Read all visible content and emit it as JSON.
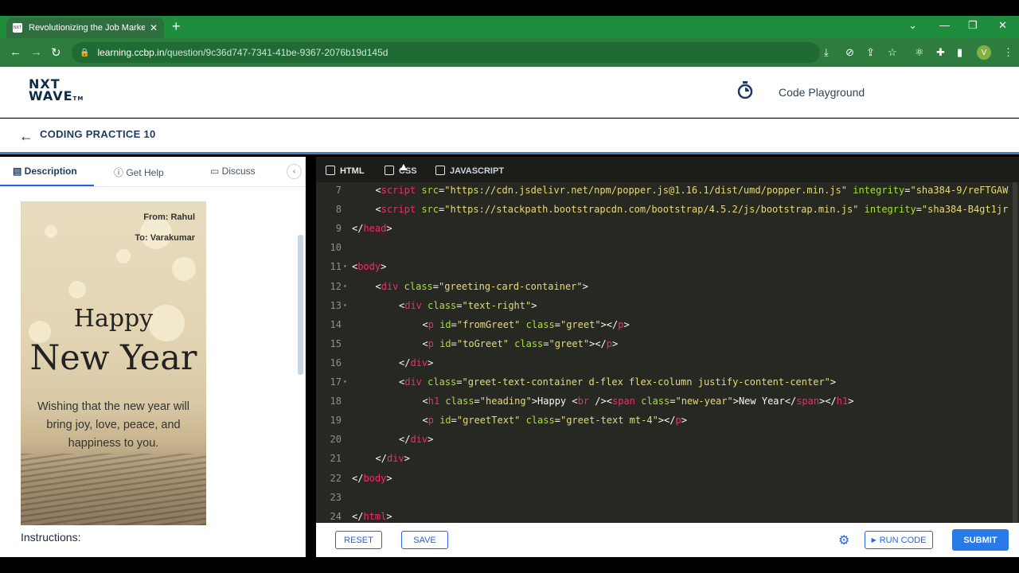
{
  "browser": {
    "tab_title": "Revolutionizing the Job Market |",
    "url_host": "learning.ccbp.in",
    "url_path": "/question/9c36d747-7341-41be-9367-2076b19d145d",
    "avatar_letter": "V",
    "favicon_text": "NXT"
  },
  "site": {
    "logo_line1": "NXT",
    "logo_line2": "WAVE",
    "logo_tm": "TM",
    "playground_label": "Code Playground",
    "practice_title": "CODING PRACTICE 10"
  },
  "left_tabs": {
    "description": "Description",
    "get_help": "Get Help",
    "discuss": "Discuss"
  },
  "card": {
    "from": "From: Rahul",
    "to": "To: Varakumar",
    "happy": "Happy",
    "new_year": "New Year",
    "wish": "Wishing that the new year will bring joy, love, peace, and happiness to you."
  },
  "instructions_label": "Instructions:",
  "editor_tabs": {
    "html": "HTML",
    "css": "CSS",
    "js": "JAVASCRIPT"
  },
  "code_lines": [
    {
      "n": "7",
      "indent": 1,
      "parts": [
        [
          "p",
          "<"
        ],
        [
          "tg",
          "script"
        ],
        [
          "p",
          " "
        ],
        [
          "at",
          "src"
        ],
        [
          "p",
          "="
        ],
        [
          "st",
          "\"https://cdn.jsdelivr.net/npm/popper.js@1.16.1/dist/umd/popper.min.js\""
        ],
        [
          "p",
          " "
        ],
        [
          "at",
          "integrity"
        ],
        [
          "p",
          "="
        ],
        [
          "st",
          "\"sha384-9/reFTGAW"
        ]
      ]
    },
    {
      "n": "8",
      "indent": 1,
      "parts": [
        [
          "p",
          "<"
        ],
        [
          "tg",
          "script"
        ],
        [
          "p",
          " "
        ],
        [
          "at",
          "src"
        ],
        [
          "p",
          "="
        ],
        [
          "st",
          "\"https://stackpath.bootstrapcdn.com/bootstrap/4.5.2/js/bootstrap.min.js\""
        ],
        [
          "p",
          " "
        ],
        [
          "at",
          "integrity"
        ],
        [
          "p",
          "="
        ],
        [
          "st",
          "\"sha384-B4gt1jr"
        ]
      ]
    },
    {
      "n": "9",
      "indent": 0,
      "parts": [
        [
          "p",
          "</"
        ],
        [
          "tg",
          "head"
        ],
        [
          "p",
          ">"
        ]
      ]
    },
    {
      "n": "10",
      "indent": 0,
      "parts": []
    },
    {
      "n": "11",
      "indent": 0,
      "fold": true,
      "parts": [
        [
          "p",
          "<"
        ],
        [
          "tg",
          "body"
        ],
        [
          "p",
          ">"
        ]
      ]
    },
    {
      "n": "12",
      "indent": 1,
      "fold": true,
      "parts": [
        [
          "p",
          "<"
        ],
        [
          "tg",
          "div"
        ],
        [
          "p",
          " "
        ],
        [
          "at",
          "class"
        ],
        [
          "p",
          "="
        ],
        [
          "st",
          "\"greeting-card-container\""
        ],
        [
          "p",
          ">"
        ]
      ]
    },
    {
      "n": "13",
      "indent": 2,
      "fold": true,
      "parts": [
        [
          "p",
          "<"
        ],
        [
          "tg",
          "div"
        ],
        [
          "p",
          " "
        ],
        [
          "at",
          "class"
        ],
        [
          "p",
          "="
        ],
        [
          "st",
          "\"text-right\""
        ],
        [
          "p",
          ">"
        ]
      ]
    },
    {
      "n": "14",
      "indent": 3,
      "parts": [
        [
          "p",
          "<"
        ],
        [
          "tg",
          "p"
        ],
        [
          "p",
          " "
        ],
        [
          "at",
          "id"
        ],
        [
          "p",
          "="
        ],
        [
          "st",
          "\"fromGreet\""
        ],
        [
          "p",
          " "
        ],
        [
          "at",
          "class"
        ],
        [
          "p",
          "="
        ],
        [
          "st",
          "\"greet\""
        ],
        [
          "p",
          "></"
        ],
        [
          "tg",
          "p"
        ],
        [
          "p",
          ">"
        ]
      ]
    },
    {
      "n": "15",
      "indent": 3,
      "parts": [
        [
          "p",
          "<"
        ],
        [
          "tg",
          "p"
        ],
        [
          "p",
          " "
        ],
        [
          "at",
          "id"
        ],
        [
          "p",
          "="
        ],
        [
          "st",
          "\"toGreet\""
        ],
        [
          "p",
          " "
        ],
        [
          "at",
          "class"
        ],
        [
          "p",
          "="
        ],
        [
          "st",
          "\"greet\""
        ],
        [
          "p",
          "></"
        ],
        [
          "tg",
          "p"
        ],
        [
          "p",
          ">"
        ]
      ]
    },
    {
      "n": "16",
      "indent": 2,
      "parts": [
        [
          "p",
          "</"
        ],
        [
          "tg",
          "div"
        ],
        [
          "p",
          ">"
        ]
      ]
    },
    {
      "n": "17",
      "indent": 2,
      "fold": true,
      "parts": [
        [
          "p",
          "<"
        ],
        [
          "tg",
          "div"
        ],
        [
          "p",
          " "
        ],
        [
          "at",
          "class"
        ],
        [
          "p",
          "="
        ],
        [
          "st",
          "\"greet-text-container d-flex flex-column justify-content-center\""
        ],
        [
          "p",
          ">"
        ]
      ]
    },
    {
      "n": "18",
      "indent": 3,
      "parts": [
        [
          "p",
          "<"
        ],
        [
          "tg",
          "h1"
        ],
        [
          "p",
          " "
        ],
        [
          "at",
          "class"
        ],
        [
          "p",
          "="
        ],
        [
          "st",
          "\"heading\""
        ],
        [
          "p",
          ">Happy <"
        ],
        [
          "tg",
          "br"
        ],
        [
          "p",
          " /><"
        ],
        [
          "tg",
          "span"
        ],
        [
          "p",
          " "
        ],
        [
          "at",
          "class"
        ],
        [
          "p",
          "="
        ],
        [
          "st",
          "\"new-year\""
        ],
        [
          "p",
          ">New Year</"
        ],
        [
          "tg",
          "span"
        ],
        [
          "p",
          "></"
        ],
        [
          "tg",
          "h1"
        ],
        [
          "p",
          ">"
        ]
      ]
    },
    {
      "n": "19",
      "indent": 3,
      "parts": [
        [
          "p",
          "<"
        ],
        [
          "tg",
          "p"
        ],
        [
          "p",
          " "
        ],
        [
          "at",
          "id"
        ],
        [
          "p",
          "="
        ],
        [
          "st",
          "\"greetText\""
        ],
        [
          "p",
          " "
        ],
        [
          "at",
          "class"
        ],
        [
          "p",
          "="
        ],
        [
          "st",
          "\"greet-text mt-4\""
        ],
        [
          "p",
          "></"
        ],
        [
          "tg",
          "p"
        ],
        [
          "p",
          ">"
        ]
      ]
    },
    {
      "n": "20",
      "indent": 2,
      "parts": [
        [
          "p",
          "</"
        ],
        [
          "tg",
          "div"
        ],
        [
          "p",
          ">"
        ]
      ]
    },
    {
      "n": "21",
      "indent": 1,
      "parts": [
        [
          "p",
          "</"
        ],
        [
          "tg",
          "div"
        ],
        [
          "p",
          ">"
        ]
      ]
    },
    {
      "n": "22",
      "indent": 0,
      "parts": [
        [
          "p",
          "</"
        ],
        [
          "tg",
          "body"
        ],
        [
          "p",
          ">"
        ]
      ]
    },
    {
      "n": "23",
      "indent": 0,
      "parts": []
    },
    {
      "n": "24",
      "indent": 0,
      "parts": [
        [
          "p",
          "</"
        ],
        [
          "tg",
          "html"
        ],
        [
          "p",
          ">"
        ]
      ]
    }
  ],
  "buttons": {
    "reset": "RESET",
    "save": "SAVE",
    "run_code": "RUN CODE",
    "submit": "SUBMIT"
  },
  "colors": {
    "chrome_green": "#1e8e3e",
    "editor_bg": "#272822",
    "accent_blue": "#2563eb",
    "tag": "#f92672",
    "attr": "#a6e22e",
    "string": "#e6db74"
  }
}
